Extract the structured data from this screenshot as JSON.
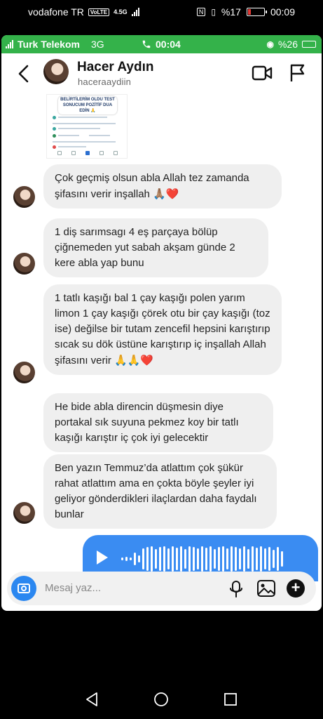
{
  "system_status": {
    "carrier": "vodafone TR",
    "volte": "VoLTE",
    "network": "4.5G",
    "battery": "%17",
    "time": "00:09",
    "battery_level": 0.17
  },
  "call_bar": {
    "carrier": "Turk Telekom",
    "network": "3G",
    "duration": "00:04",
    "battery": "%26"
  },
  "chat": {
    "name": "Hacer Aydın",
    "username": "haceraaydiin"
  },
  "shared_image": {
    "caption": "BELİRTİLERİM OLDU TEST SONUCUM POZİTİF DUA EDİN 🙏"
  },
  "messages": [
    {
      "text": "Çok geçmiş olsun abla Allah tez zamanda şifasını verir inşallah",
      "emoji": "🙏🏽❤️"
    },
    {
      "text": "1 diş sarımsagı 4 eş parçaya bölüp çiğnemeden yut sabah akşam günde 2 kere abla yap bunu",
      "emoji": ""
    },
    {
      "text": "1 tatlı kaşığı bal 1 çay kaşığı polen yarım limon 1 çay kaşığı çörek otu bir çay kaşığı (toz ise) değilse bir tutam zencefil hepsini karıştırıp sıcak su dök üstüne karıştırıp iç inşallah Allah şifasını verir",
      "emoji": "🙏🙏❤️"
    },
    {
      "text": "He bide abla direncin düşmesin diye portakal sık suyuna pekmez koy bir tatlı kaşığı karıştır iç çok iyi gelecektir",
      "emoji": ""
    },
    {
      "text": "Ben yazın Temmuz’da atlattım çok şükür rahat atlattım ama en çokta böyle şeyler iyi geliyor gönderdikleri ilaçlardan daha faydalı bunlar",
      "emoji": ""
    }
  ],
  "composer": {
    "placeholder": "Mesaj yaz..."
  },
  "colors": {
    "call_green": "#34b24a",
    "voice_blue": "#3a8cf2",
    "camera_blue": "#2b87f0",
    "bubble_gray": "#efefef"
  }
}
